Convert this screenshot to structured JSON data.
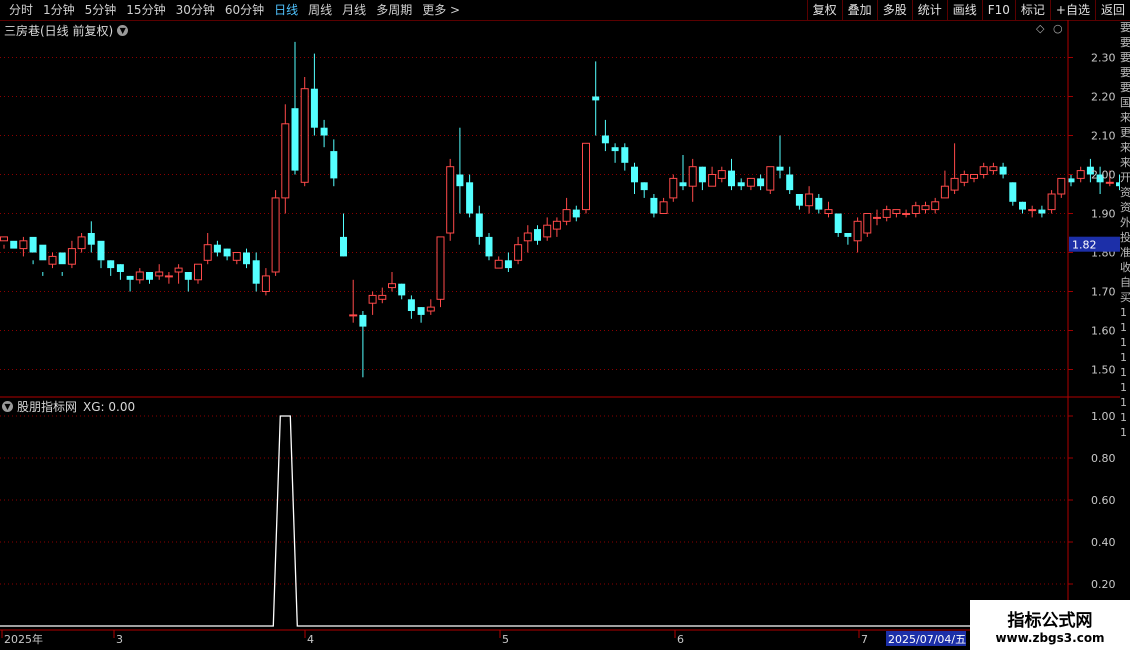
{
  "toolbar": {
    "periods": [
      "分时",
      "1分钟",
      "5分钟",
      "15分钟",
      "30分钟",
      "60分钟",
      "日线",
      "周线",
      "月线",
      "多周期",
      "更多 >"
    ],
    "active_period": "日线",
    "buttons": [
      "复权",
      "叠加",
      "多股",
      "统计",
      "画线",
      "F10",
      "标记",
      "+自选",
      "返回"
    ]
  },
  "main_chart": {
    "title": "三房巷(日线 前复权)",
    "price_label": "1.82",
    "y_ticks": [
      "2.30",
      "2.20",
      "2.10",
      "2.00",
      "1.90",
      "1.80",
      "1.70",
      "1.60",
      "1.50"
    ]
  },
  "indicator": {
    "title": "股朋指标网",
    "value_text": "XG: 0.00",
    "y_ticks": [
      "1.00",
      "0.80",
      "0.60",
      "0.40",
      "0.20"
    ]
  },
  "x_axis": {
    "labels": [
      "2025年",
      "3",
      "4",
      "5",
      "6",
      "7"
    ],
    "cursor_date": "2025/07/04/五"
  },
  "right_strip": [
    "要",
    "要",
    "要",
    "要",
    "要",
    "国",
    "来",
    "更",
    "来",
    "来",
    "开",
    "资",
    "资",
    "外",
    "投",
    "准",
    "收",
    "",
    "",
    "",
    "",
    "",
    "",
    "",
    "",
    "自",
    "买",
    "1",
    "1",
    "1",
    "1",
    "1",
    "1",
    "1",
    "1",
    "1"
  ],
  "watermark": {
    "title": "指标公式网",
    "url": "www.zbgs3.com"
  },
  "colors": {
    "up": "#ff4a4a",
    "down": "#54ffff",
    "grid": "#8b0000",
    "axis_text": "#c8c8c8",
    "highlight": "#1c2fa8"
  },
  "chart_data": {
    "type": "candlestick",
    "price_axis": [
      1.45,
      2.35
    ],
    "candles": [
      [
        1.83,
        1.84,
        1.82,
        1.81
      ],
      [
        1.83,
        1.81,
        1.79,
        1.79
      ],
      [
        1.81,
        1.83,
        1.84,
        1.79
      ],
      [
        1.84,
        1.8,
        1.78,
        1.77
      ],
      [
        1.82,
        1.78,
        1.75,
        1.74
      ],
      [
        1.77,
        1.79,
        1.8,
        1.76
      ],
      [
        1.8,
        1.77,
        1.75,
        1.74
      ],
      [
        1.77,
        1.81,
        1.83,
        1.76
      ],
      [
        1.81,
        1.84,
        1.85,
        1.8
      ],
      [
        1.85,
        1.82,
        1.88,
        1.8
      ],
      [
        1.83,
        1.78,
        1.78,
        1.76
      ],
      [
        1.78,
        1.76,
        1.78,
        1.74
      ],
      [
        1.77,
        1.75,
        1.77,
        1.73
      ],
      [
        1.74,
        1.73,
        1.74,
        1.7
      ],
      [
        1.73,
        1.75,
        1.76,
        1.72
      ],
      [
        1.75,
        1.73,
        1.75,
        1.72
      ],
      [
        1.74,
        1.75,
        1.77,
        1.73
      ],
      [
        1.74,
        1.74,
        1.75,
        1.72
      ],
      [
        1.75,
        1.76,
        1.77,
        1.72
      ],
      [
        1.75,
        1.73,
        1.74,
        1.7
      ],
      [
        1.73,
        1.77,
        1.77,
        1.72
      ],
      [
        1.78,
        1.82,
        1.85,
        1.77
      ],
      [
        1.82,
        1.8,
        1.83,
        1.79
      ],
      [
        1.81,
        1.79,
        1.81,
        1.78
      ],
      [
        1.78,
        1.8,
        1.8,
        1.77
      ],
      [
        1.8,
        1.77,
        1.81,
        1.76
      ],
      [
        1.78,
        1.72,
        1.8,
        1.7
      ],
      [
        1.7,
        1.74,
        1.76,
        1.69
      ],
      [
        1.75,
        1.94,
        1.96,
        1.74
      ],
      [
        1.94,
        2.13,
        2.18,
        1.9
      ],
      [
        2.17,
        2.01,
        2.34,
        2.0
      ],
      [
        1.98,
        2.22,
        2.25,
        1.97
      ],
      [
        2.22,
        2.12,
        2.31,
        2.1
      ],
      [
        2.12,
        2.1,
        2.14,
        2.07
      ],
      [
        2.06,
        1.99,
        2.09,
        1.97
      ],
      [
        1.84,
        1.79,
        1.9,
        1.79
      ],
      [
        1.64,
        1.64,
        1.73,
        1.62
      ],
      [
        1.64,
        1.61,
        1.65,
        1.48
      ],
      [
        1.67,
        1.69,
        1.7,
        1.64
      ],
      [
        1.68,
        1.69,
        1.71,
        1.67
      ],
      [
        1.71,
        1.72,
        1.75,
        1.7
      ],
      [
        1.72,
        1.69,
        1.72,
        1.68
      ],
      [
        1.68,
        1.65,
        1.69,
        1.63
      ],
      [
        1.66,
        1.64,
        1.66,
        1.62
      ],
      [
        1.65,
        1.66,
        1.68,
        1.64
      ],
      [
        1.68,
        1.84,
        1.84,
        1.66
      ],
      [
        1.85,
        2.02,
        2.04,
        1.83
      ],
      [
        2.0,
        1.97,
        2.12,
        1.9
      ],
      [
        1.98,
        1.9,
        2.0,
        1.89
      ],
      [
        1.9,
        1.84,
        1.92,
        1.82
      ],
      [
        1.84,
        1.79,
        1.85,
        1.78
      ],
      [
        1.76,
        1.78,
        1.79,
        1.76
      ],
      [
        1.78,
        1.76,
        1.8,
        1.75
      ],
      [
        1.78,
        1.82,
        1.84,
        1.77
      ],
      [
        1.83,
        1.85,
        1.87,
        1.8
      ],
      [
        1.86,
        1.83,
        1.87,
        1.82
      ],
      [
        1.84,
        1.87,
        1.89,
        1.83
      ],
      [
        1.86,
        1.88,
        1.89,
        1.84
      ],
      [
        1.88,
        1.91,
        1.94,
        1.87
      ],
      [
        1.91,
        1.89,
        1.92,
        1.88
      ],
      [
        1.91,
        2.08,
        2.08,
        1.9
      ],
      [
        2.2,
        2.19,
        2.29,
        2.1
      ],
      [
        2.1,
        2.08,
        2.14,
        2.06
      ],
      [
        2.07,
        2.06,
        2.08,
        2.03
      ],
      [
        2.07,
        2.03,
        2.08,
        2.01
      ],
      [
        2.02,
        1.98,
        2.03,
        1.95
      ],
      [
        1.98,
        1.96,
        1.98,
        1.94
      ],
      [
        1.94,
        1.9,
        1.95,
        1.89
      ],
      [
        1.9,
        1.93,
        1.94,
        1.9
      ],
      [
        1.94,
        1.99,
        2.0,
        1.93
      ],
      [
        1.98,
        1.97,
        2.05,
        1.96
      ],
      [
        1.97,
        2.02,
        2.04,
        1.93
      ],
      [
        2.02,
        1.98,
        2.02,
        1.96
      ],
      [
        1.97,
        2.0,
        2.02,
        1.97
      ],
      [
        1.99,
        2.01,
        2.02,
        1.98
      ],
      [
        2.01,
        1.97,
        2.04,
        1.96
      ],
      [
        1.98,
        1.97,
        1.99,
        1.96
      ],
      [
        1.97,
        1.99,
        1.99,
        1.96
      ],
      [
        1.99,
        1.97,
        2.0,
        1.96
      ],
      [
        1.96,
        2.02,
        2.02,
        1.95
      ],
      [
        2.02,
        2.01,
        2.1,
        1.99
      ],
      [
        2.0,
        1.96,
        2.02,
        1.95
      ],
      [
        1.95,
        1.92,
        1.95,
        1.91
      ],
      [
        1.92,
        1.95,
        1.97,
        1.9
      ],
      [
        1.94,
        1.91,
        1.95,
        1.9
      ],
      [
        1.9,
        1.91,
        1.93,
        1.89
      ],
      [
        1.9,
        1.85,
        1.9,
        1.84
      ],
      [
        1.85,
        1.84,
        1.85,
        1.82
      ],
      [
        1.83,
        1.88,
        1.89,
        1.8
      ],
      [
        1.85,
        1.9,
        1.9,
        1.84
      ],
      [
        1.89,
        1.89,
        1.91,
        1.87
      ],
      [
        1.89,
        1.91,
        1.92,
        1.88
      ],
      [
        1.9,
        1.91,
        1.91,
        1.89
      ],
      [
        1.9,
        1.9,
        1.91,
        1.89
      ],
      [
        1.9,
        1.92,
        1.93,
        1.89
      ],
      [
        1.91,
        1.92,
        1.93,
        1.9
      ],
      [
        1.91,
        1.93,
        1.94,
        1.9
      ],
      [
        1.94,
        1.97,
        2.01,
        1.94
      ],
      [
        1.96,
        1.99,
        2.08,
        1.95
      ],
      [
        1.98,
        2.0,
        2.01,
        1.97
      ],
      [
        1.99,
        2.0,
        2.0,
        1.98
      ],
      [
        2.0,
        2.02,
        2.03,
        1.99
      ],
      [
        2.01,
        2.02,
        2.03,
        2.0
      ],
      [
        2.02,
        2.0,
        2.03,
        1.99
      ],
      [
        1.98,
        1.93,
        1.98,
        1.92
      ],
      [
        1.93,
        1.91,
        1.93,
        1.9
      ],
      [
        1.91,
        1.91,
        1.92,
        1.89
      ],
      [
        1.91,
        1.9,
        1.92,
        1.89
      ],
      [
        1.91,
        1.95,
        1.96,
        1.9
      ],
      [
        1.95,
        1.99,
        1.99,
        1.94
      ],
      [
        1.99,
        1.98,
        2.0,
        1.97
      ],
      [
        1.99,
        2.01,
        2.02,
        1.98
      ],
      [
        2.02,
        2.0,
        2.04,
        1.98
      ],
      [
        2.0,
        1.98,
        2.02,
        1.95
      ],
      [
        1.98,
        1.98,
        2.01,
        1.97
      ],
      [
        1.98,
        1.97,
        2.0,
        1.96
      ],
      [
        1.97,
        1.93,
        1.98,
        1.92
      ]
    ],
    "indicator_axis": [
      0,
      1.05
    ],
    "indicator_series": {
      "name": "XG",
      "signal_bar_index": 29,
      "signal_value": 1.0
    }
  }
}
